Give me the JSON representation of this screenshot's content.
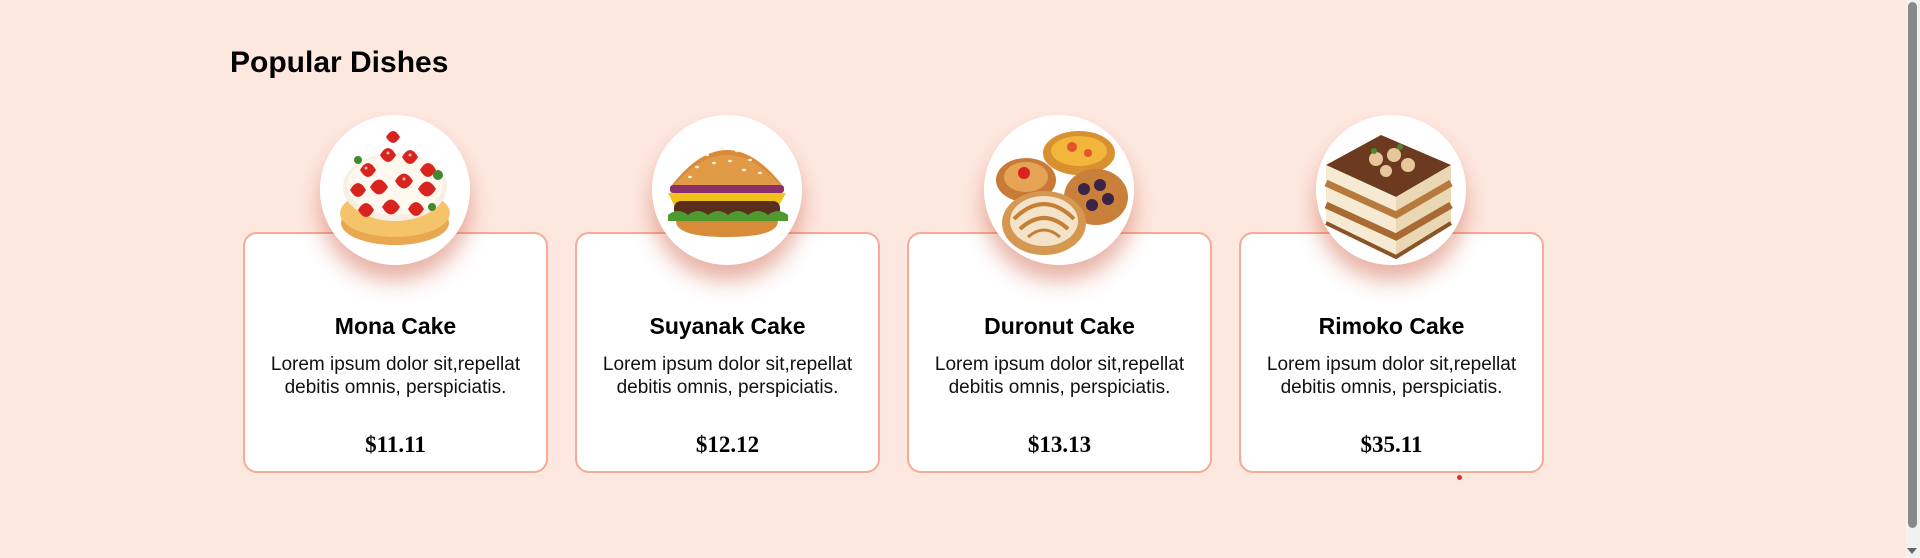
{
  "section": {
    "title": "Popular Dishes"
  },
  "dishes": [
    {
      "name": "Mona Cake",
      "description": "Lorem ipsum dolor sit,repellat debitis omnis, perspiciatis.",
      "price": "$11.11",
      "icon": "strawberry-cake-image"
    },
    {
      "name": "Suyanak Cake",
      "description": "Lorem ipsum dolor sit,repellat debitis omnis, perspiciatis.",
      "price": "$12.12",
      "icon": "burger-image"
    },
    {
      "name": "Duronut Cake",
      "description": "Lorem ipsum dolor sit,repellat debitis omnis, perspiciatis.",
      "price": "$13.13",
      "icon": "pastries-image"
    },
    {
      "name": "Rimoko Cake",
      "description": "Lorem ipsum dolor sit,repellat debitis omnis, perspiciatis.",
      "price": "$35.11",
      "icon": "tiramisu-image"
    }
  ],
  "colors": {
    "background": "#fde8e0",
    "card_border": "#f5ab94",
    "card_background": "#ffffff",
    "shadow": "#cd5537"
  }
}
